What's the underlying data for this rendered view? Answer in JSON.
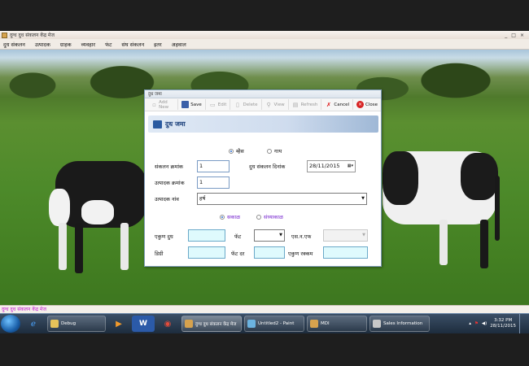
{
  "app": {
    "title": "दुग्ध दुध संकलन केंद्र मेज",
    "window_controls": [
      "_",
      "□",
      "×"
    ],
    "menu": [
      "दुध संकलन",
      "उत्पादक",
      "ग्राहक",
      "व्यवहार",
      "फंट",
      "संघ संकलन",
      "इतर",
      "अहवाल"
    ],
    "status_text": "दुग्ध दुध संकलन केंद्र मेज"
  },
  "form": {
    "title": "दुध जमा",
    "header": "दुध जमा",
    "toolbar": {
      "add_new": "Add New",
      "save": "Save",
      "edit": "Edit",
      "delete": "Delete",
      "view": "View",
      "refresh": "Refresh",
      "cancel": "Cancel",
      "close": "Close"
    },
    "animal": {
      "options": [
        "म्हैस",
        "गाय"
      ],
      "selected": "म्हैस"
    },
    "fields": {
      "sankalan_kramank_label": "संकलन क्रमांक",
      "sankalan_kramank_value": "1",
      "sankalan_dinank_label": "दुध संकलन दिनांक",
      "sankalan_dinank_value": "28/11/2015",
      "utpadak_kramank_label": "उत्पादक क्रमांक",
      "utpadak_kramank_value": "1",
      "utpadak_nav_label": "उत्पादक नांव",
      "utpadak_nav_value": "हर्ष"
    },
    "shift": {
      "options": [
        "सकाळ",
        "संध्याकाळ"
      ],
      "selected": "सकाळ"
    },
    "bottom": {
      "ekun_dudh_label": "एकुण दुध",
      "ekun_dudh_value": "",
      "fat_label": "फॅट",
      "fat_value": "",
      "snf_label": "एस.न.एफ",
      "snf_value": "",
      "degree_label": "डिग्री",
      "degree_value": "",
      "fat_dar_label": "फॅट दर",
      "fat_dar_value": "",
      "ekun_rakkam_label": "एकुण रक्कम",
      "ekun_rakkam_value": ""
    }
  },
  "taskbar": {
    "items": [
      "Debug",
      "दुग्ध दुध संकलन केंद्र मेज",
      "Untitled2 - Paint",
      "MDI",
      "Sales Information"
    ],
    "time": "3:32 PM",
    "date": "28/11/2015"
  },
  "colors": {
    "accent": "#2c6ed1",
    "input_highlight": "#dffafd",
    "status_text": "#c21bd1"
  }
}
